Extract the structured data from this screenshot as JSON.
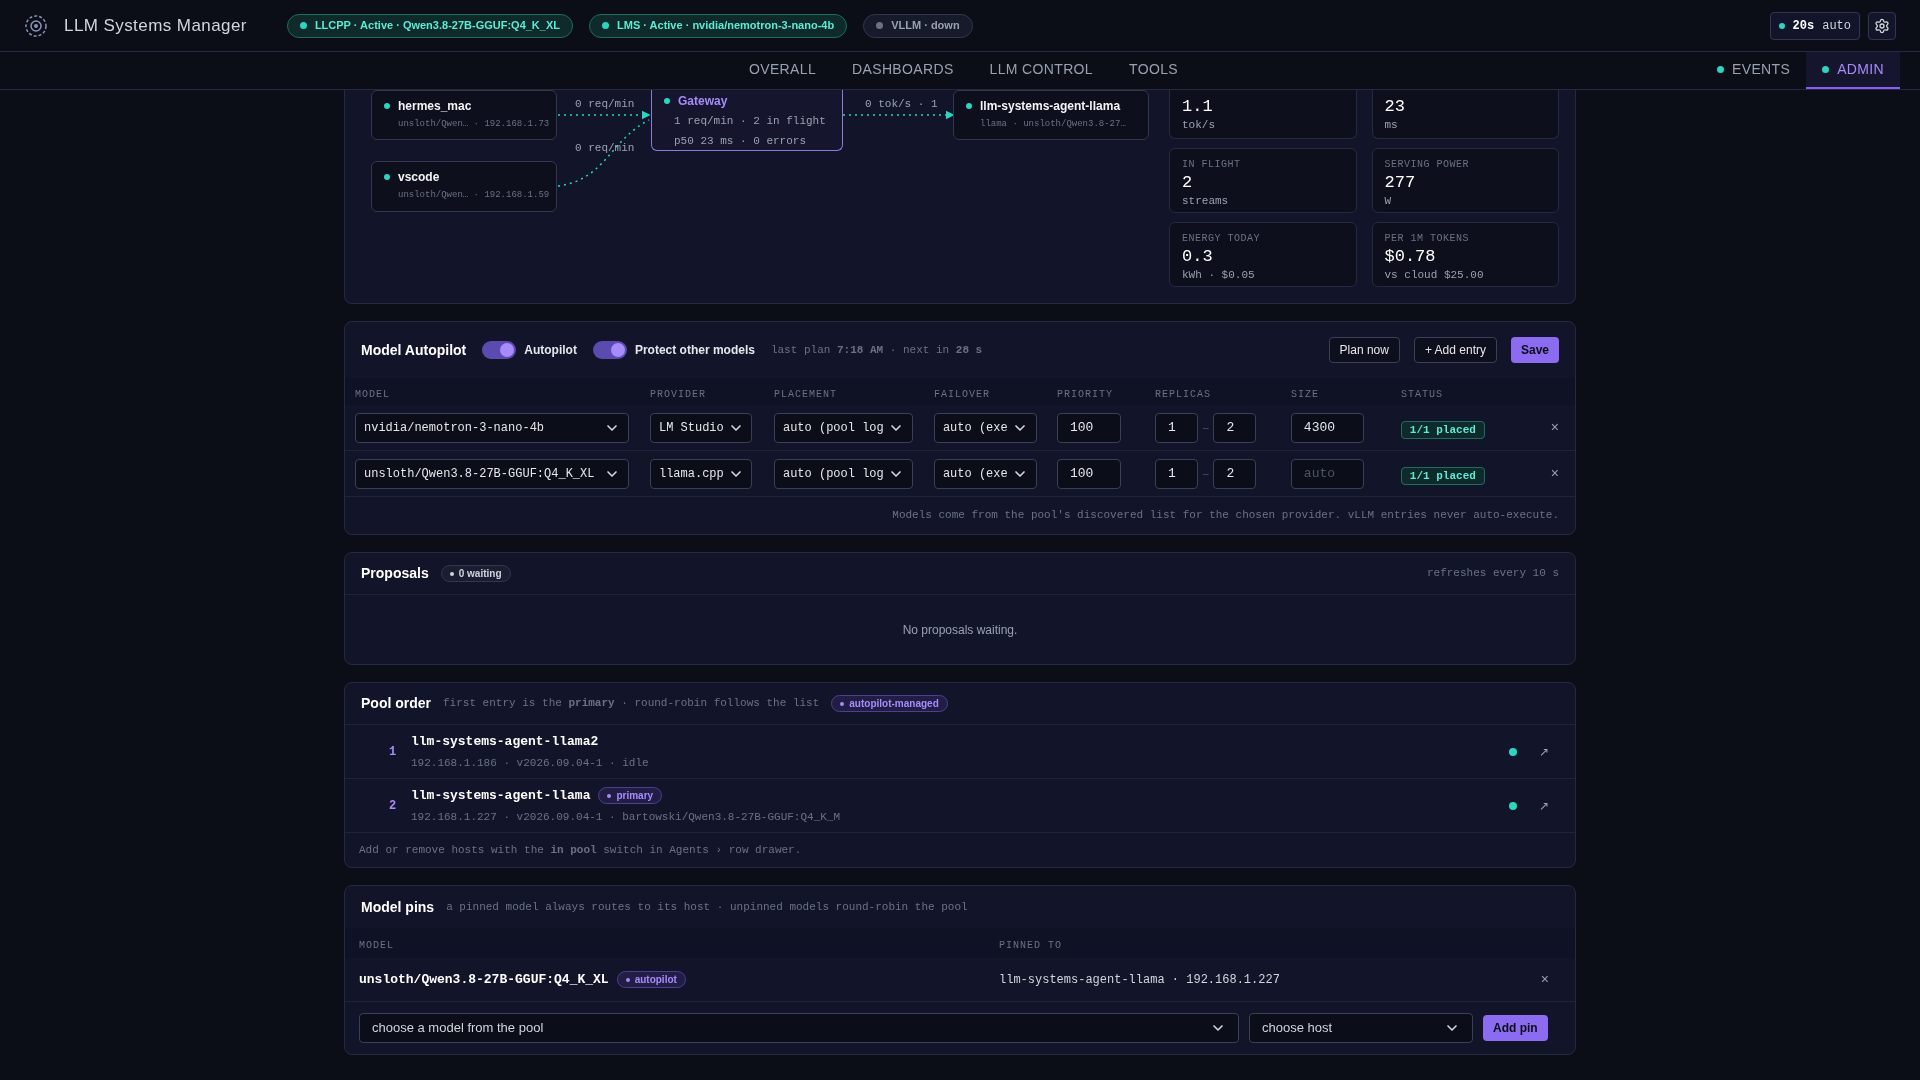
{
  "app": {
    "title": "LLM Systems Manager"
  },
  "status_pills": [
    {
      "label": "LLCPP · Active · Qwen3.8-27B-GGUF:Q4_K_XL",
      "color": "#2dd4bf"
    },
    {
      "label": "LMS · Active · nvidia/nemotron-3-nano-4b",
      "color": "#2dd4bf"
    },
    {
      "label": "VLLM · down",
      "color": "#6b7280"
    }
  ],
  "refresh": {
    "interval": "20s",
    "mode": "auto",
    "color": "#2dd4bf"
  },
  "nav": {
    "tabs": [
      {
        "label": "OVERALL",
        "selected": false
      },
      {
        "label": "DASHBOARDS",
        "selected": false
      },
      {
        "label": "LLM CONTROL",
        "selected": false
      },
      {
        "label": "TOOLS",
        "selected": false
      }
    ],
    "right_tabs": [
      {
        "label": "EVENTS",
        "selected": false,
        "color": "#2dd4bf"
      },
      {
        "label": "ADMIN",
        "selected": true,
        "color": "#2dd4bf"
      }
    ]
  },
  "flow": {
    "clients": [
      {
        "name": "hermes_mac",
        "detail": "unsloth/Qwen… · 192.168.1.73",
        "rate": "0 req/min"
      },
      {
        "name": "vscode",
        "detail": "unsloth/Qwen… · 192.168.1.59",
        "rate": "0 req/min"
      }
    ],
    "gateway": {
      "name": "Gateway",
      "line1": "1 req/min · 2 in flight",
      "line2": "p50 23 ms · 0 errors"
    },
    "output_rate": "0 tok/s · 1",
    "target": {
      "name": "llm-systems-agent-llama",
      "detail": "llama · unsloth/Qwen3.8-27…"
    }
  },
  "stats": [
    {
      "value": "1.1",
      "unit": "tok/s"
    },
    {
      "value": "23",
      "unit": "ms"
    },
    {
      "label": "IN FLIGHT",
      "value": "2",
      "unit": "streams"
    },
    {
      "label": "SERVING POWER",
      "value": "277",
      "unit": "W"
    },
    {
      "label": "ENERGY TODAY",
      "value": "0.3",
      "unit": "kWh · $0.05"
    },
    {
      "label": "PER 1M TOKENS",
      "value": "$0.78",
      "unit": "vs cloud $25.00"
    }
  ],
  "autopilot": {
    "title": "Model Autopilot",
    "toggles": [
      {
        "label": "Autopilot",
        "on": true
      },
      {
        "label": "Protect other models",
        "on": true
      }
    ],
    "plan_info": "last plan **7:18 AM** · next in **28 s**",
    "buttons": [
      {
        "label": "Plan now",
        "kind": "outline"
      },
      {
        "label": "+ Add entry",
        "kind": "outline"
      },
      {
        "label": "Save",
        "kind": "primary"
      }
    ],
    "columns": [
      "MODEL",
      "PROVIDER",
      "PLACEMENT",
      "FAILOVER",
      "PRIORITY",
      "REPLICAS",
      "SIZE",
      "STATUS"
    ],
    "rows": [
      {
        "model": "nvidia/nemotron-3-nano-4b",
        "provider": "LM Studio",
        "placement": "auto (pool log",
        "failover": "auto (exe",
        "priority": "100",
        "replicas_min": "1",
        "separator": "–",
        "replicas_max": "2",
        "size": "4300",
        "status": "1/1 placed",
        "remove": "×"
      },
      {
        "model": "unsloth/Qwen3.8-27B-GGUF:Q4_K_XL",
        "provider": "llama.cpp",
        "placement": "auto (pool log",
        "failover": "auto (exe",
        "priority": "100",
        "replicas_min": "1",
        "separator": "–",
        "replicas_max": "2",
        "size_placeholder": "auto",
        "status": "1/1 placed",
        "remove": "×"
      }
    ],
    "footnote": "Models come from the pool's discovered list for the chosen provider. vLLM entries never auto-execute."
  },
  "proposals": {
    "title": "Proposals",
    "badge": "0 waiting",
    "refresh": "refreshes every 10 s",
    "empty": "No proposals waiting."
  },
  "pool_order": {
    "title": "Pool order",
    "subtitle": "first entry is the **primary** · round-robin follows the list",
    "badge": "autopilot-managed",
    "entries": [
      {
        "rank": "1",
        "name": "llm-systems-agent-llama2",
        "detail": "192.168.1.186 · v2026.09.04-1 · idle",
        "color": "#2dd4bf",
        "link": "↗"
      },
      {
        "rank": "2",
        "name": "llm-systems-agent-llama",
        "badge": "primary",
        "detail": "192.168.1.227 · v2026.09.04-1 · bartowski/Qwen3.8-27B-GGUF:Q4_K_M",
        "color": "#2dd4bf",
        "link": "↗"
      }
    ],
    "footnote": "Add or remove hosts with the **in pool** switch in Agents › row drawer."
  },
  "model_pins": {
    "title": "Model pins",
    "subtitle": "a pinned model always routes to its host · unpinned models round-robin the pool",
    "columns": [
      "MODEL",
      "PINNED TO"
    ],
    "rows": [
      {
        "model": "unsloth/Qwen3.8-27B-GGUF:Q4_K_XL",
        "badge": "autopilot",
        "pinned_to": "llm-systems-agent-llama · 192.168.1.227",
        "remove": "×"
      }
    ],
    "model_select": {
      "placeholder": "choose a model from the pool"
    },
    "host_select": {
      "placeholder": "choose host"
    },
    "add_button": "Add pin"
  }
}
